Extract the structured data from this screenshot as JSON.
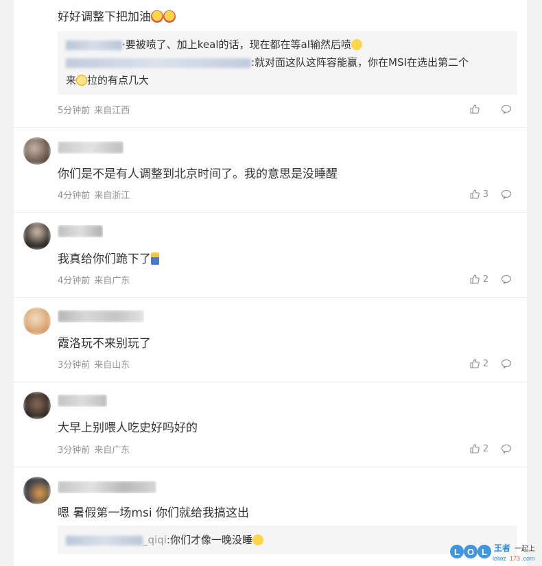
{
  "comments": [
    {
      "text": "好好调整下把加油",
      "time": "5分钟前",
      "location": "来自江西",
      "likes": "",
      "replies": [
        {
          "text": "·要被喷了、加上keal的话，现在都在等al输然后喷"
        },
        {
          "text": ":就对面这队这阵容能赢，你在MSI在选出第二个"
        },
        {
          "text": "拉的有点几大",
          "prefix": "来"
        }
      ]
    },
    {
      "text": "你们是不是有人调整到北京时间了。我的意思是没睡醒",
      "time": "4分钟前",
      "location": "来自浙江",
      "likes": "3"
    },
    {
      "text": "我真给你们跪下了",
      "time": "4分钟前",
      "location": "来自广东",
      "likes": "2"
    },
    {
      "text": "霞洛玩不来别玩了",
      "time": "3分钟前",
      "location": "来自山东",
      "likes": "2"
    },
    {
      "text": "大早上别喂人吃史好吗好的",
      "time": "3分钟前",
      "location": "来自广东",
      "likes": "2"
    },
    {
      "text": "嗯 暑假第一场msi 你们就给我搞这出",
      "replies": [
        {
          "nick_tail": "_qiqi",
          "text": ":你们才像一晚没睡"
        }
      ]
    }
  ],
  "watermark": {
    "logo": "LOL",
    "brand": "王者一起上",
    "site": "lolwz173.com"
  },
  "colors": {
    "meta": "#939393",
    "text": "#333333",
    "reply_bg": "#f5f5f5",
    "accent": "#2b8cdc"
  }
}
